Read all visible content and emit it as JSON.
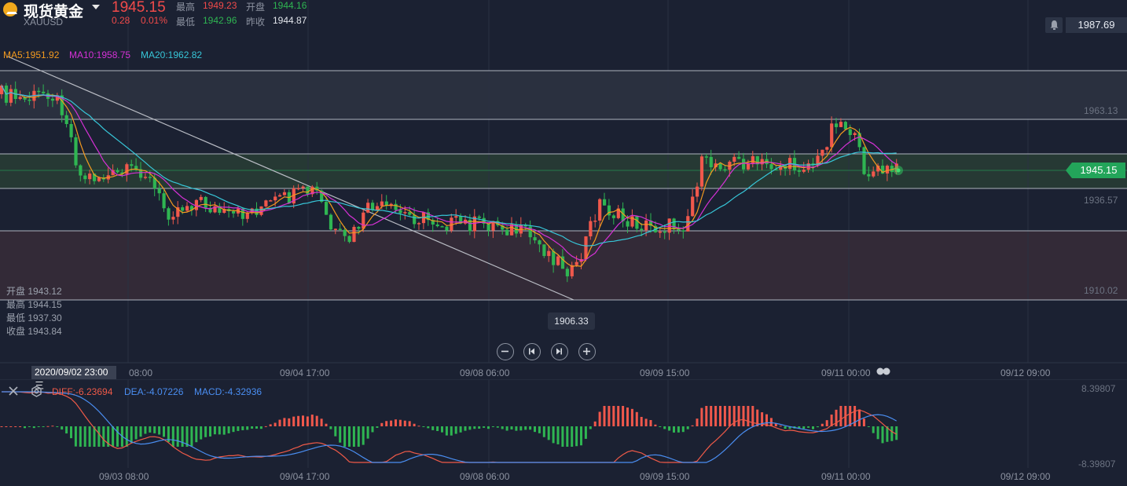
{
  "header": {
    "name": "现货黄金",
    "code": "XAUUSD",
    "price": "1945.15",
    "change": "0.28",
    "change_pct": "0.01%",
    "high_label": "最高",
    "high": "1949.23",
    "low_label": "最低",
    "low": "1942.96",
    "open_label": "开盘",
    "open": "1944.16",
    "prev_close_label": "昨收",
    "prev_close": "1944.87"
  },
  "top_right_price": "1987.69",
  "ma": {
    "ma5": "MA5:1951.92",
    "ma10": "MA10:1958.75",
    "ma20": "MA20:1962.82"
  },
  "axis_right": [
    "1963.13",
    "1936.57",
    "1910.02"
  ],
  "last_price": "1945.15",
  "ohlc_panel": {
    "open": "开盘 1943.12",
    "high": "最高 1944.15",
    "low": "最低 1937.30",
    "close": "收盘 1943.84"
  },
  "low_marker": "1906.33",
  "crosshair_date": "2020/09/02 23:00 三",
  "x_labels_main": [
    "08:00",
    "09/04 17:00",
    "09/08 06:00",
    "09/09 15:00",
    "09/11 00:00",
    "09/12 09:00"
  ],
  "x_labels_macd": [
    "09/03 08:00",
    "09/04 17:00",
    "09/08 06:00",
    "09/09 15:00",
    "09/11 00:00",
    "09/12 09:00"
  ],
  "macd": {
    "diff": "DIFF:-6.23694",
    "dea": "DEA:-4.07226",
    "macd": "MACD:-4.32936",
    "ymax": "8.39807",
    "ymin": "-8.39807"
  },
  "colors": {
    "up": "#f0584c",
    "down": "#2fb552",
    "ma5": "#f39a1f",
    "ma10": "#d531d6",
    "ma20": "#37c6d8",
    "diff": "#ef5a48",
    "dea": "#4a8ef2"
  }
}
